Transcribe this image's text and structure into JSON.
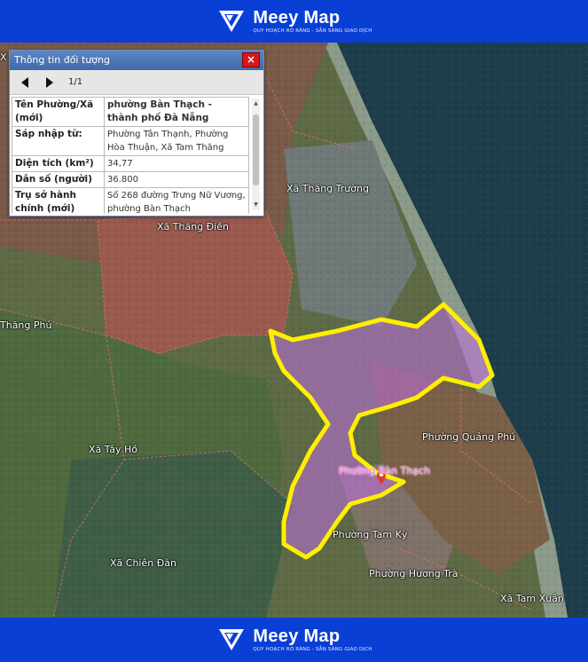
{
  "header": {
    "brand_name": "Meey Map",
    "tagline": "QUY HOẠCH RÕ RÀNG - SẴN SÀNG GIAO DỊCH"
  },
  "footer": {
    "brand_name": "Meey Map",
    "tagline": "QUY HOẠCH RÕ RÀNG - SẴN SÀNG GIAO DỊCH"
  },
  "popup": {
    "title": "Thông tin đối tượng",
    "close_label": "×",
    "pager": "1/1",
    "rows": [
      {
        "key": "Tên Phường/Xã (mới)",
        "value": "phường Bàn Thạch - thành phố Đà Nẵng"
      },
      {
        "key": "Sáp nhập từ:",
        "value": "Phường Tân Thạnh, Phường Hòa Thuận, Xã Tam Thăng"
      },
      {
        "key": "Diện tích (km²)",
        "value": "34,77"
      },
      {
        "key": "Dân số (người)",
        "value": "36.800"
      },
      {
        "key": "Trụ sở hành chính (mới)",
        "value": "Số 268 đường Trưng Nữ Vương, phường Bàn Thạch"
      }
    ]
  },
  "map": {
    "labels": {
      "thang_truong": "Xã Thăng Trường",
      "thang_dien": "Xã Thăng Điền",
      "thang_phu": "Thăng Phú",
      "tay_ho": "Xã Tây Hồ",
      "chien_dan": "Xã Chiên Đàn",
      "quang_phu": "Phường Quảng Phú",
      "ban_thach": "Phường Bàn Thạch",
      "tam_ky": "Phường Tam Kỳ",
      "huong_tra": "Phường Hương Trà",
      "tam_xuan": "Xã Tam Xuân",
      "edge_x": "X"
    },
    "selected_color": "#ffee00",
    "highlight_fill": "#c070e0"
  }
}
